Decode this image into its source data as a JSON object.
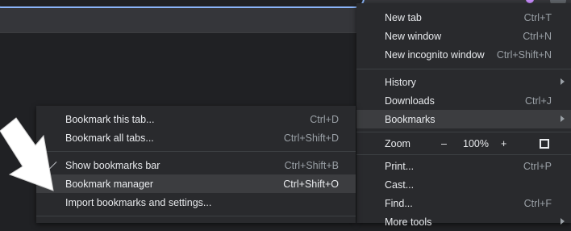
{
  "main_menu": {
    "items": [
      {
        "label": "New tab",
        "shortcut": "Ctrl+T"
      },
      {
        "label": "New window",
        "shortcut": "Ctrl+N"
      },
      {
        "label": "New incognito window",
        "shortcut": "Ctrl+Shift+N"
      },
      {
        "label": "History",
        "shortcut": ""
      },
      {
        "label": "Downloads",
        "shortcut": "Ctrl+J"
      },
      {
        "label": "Bookmarks",
        "shortcut": ""
      },
      {
        "label": "Print...",
        "shortcut": "Ctrl+P"
      },
      {
        "label": "Cast...",
        "shortcut": ""
      },
      {
        "label": "Find...",
        "shortcut": "Ctrl+F"
      },
      {
        "label": "More tools",
        "shortcut": ""
      }
    ],
    "zoom": {
      "label": "Zoom",
      "minus": "–",
      "value": "100%",
      "plus": "+"
    }
  },
  "bookmarks_submenu": {
    "items": [
      {
        "label": "Bookmark this tab...",
        "shortcut": "Ctrl+D"
      },
      {
        "label": "Bookmark all tabs...",
        "shortcut": "Ctrl+Shift+D"
      },
      {
        "label": "Show bookmarks bar",
        "shortcut": "Ctrl+Shift+B"
      },
      {
        "label": "Bookmark manager",
        "shortcut": "Ctrl+Shift+O"
      },
      {
        "label": "Import bookmarks and settings...",
        "shortcut": ""
      }
    ]
  },
  "colors": {
    "menu_bg": "#292a2d",
    "highlight": "#3c3d40",
    "accent": "#8ab4f8"
  },
  "icons": [
    "submenu-arrow-icon",
    "check-icon",
    "fullscreen-icon",
    "pointer-arrow-icon"
  ]
}
